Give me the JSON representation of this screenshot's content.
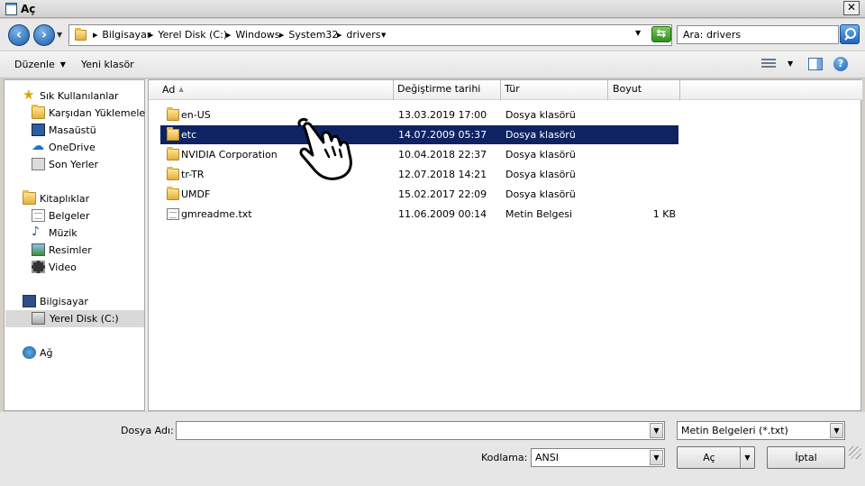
{
  "window": {
    "title": "Aç"
  },
  "address": {
    "crumbs": [
      "Bilgisayar",
      "Yerel Disk (C:)",
      "Windows",
      "System32",
      "drivers"
    ],
    "search_placeholder": "Ara: drivers"
  },
  "toolbar": {
    "organize_label": "Düzenle",
    "new_folder_label": "Yeni klasör"
  },
  "nav": {
    "favorites_label": "Sık Kullanılanlar",
    "favorites": [
      "Karşıdan Yüklemeler",
      "Masaüstü",
      "OneDrive",
      "Son Yerler"
    ],
    "libraries_label": "Kitaplıklar",
    "libraries": [
      "Belgeler",
      "Müzik",
      "Resimler",
      "Video"
    ],
    "computer_label": "Bilgisayar",
    "computer": [
      "Yerel Disk (C:)"
    ],
    "network_label": "Ağ"
  },
  "columns": {
    "name": "Ad",
    "modified": "Değiştirme tarihi",
    "type": "Tür",
    "size": "Boyut"
  },
  "files": [
    {
      "name": "en-US",
      "modified": "13.03.2019 17:00",
      "type": "Dosya klasörü",
      "size": "",
      "kind": "folder"
    },
    {
      "name": "etc",
      "modified": "14.07.2009 05:37",
      "type": "Dosya klasörü",
      "size": "",
      "kind": "folder",
      "selected": true
    },
    {
      "name": "NVIDIA Corporation",
      "modified": "10.04.2018 22:37",
      "type": "Dosya klasörü",
      "size": "",
      "kind": "folder"
    },
    {
      "name": "tr-TR",
      "modified": "12.07.2018 14:21",
      "type": "Dosya klasörü",
      "size": "",
      "kind": "folder"
    },
    {
      "name": "UMDF",
      "modified": "15.02.2017 22:09",
      "type": "Dosya klasörü",
      "size": "",
      "kind": "folder"
    },
    {
      "name": "gmreadme.txt",
      "modified": "11.06.2009 00:14",
      "type": "Metin Belgesi",
      "size": "1 KB",
      "kind": "file"
    }
  ],
  "bottom": {
    "filename_label": "Dosya Adı:",
    "filename_value": "",
    "filter_value": "Metin Belgeleri (*.txt)",
    "encoding_label": "Kodlama:",
    "encoding_value": "ANSI",
    "open_label": "Aç",
    "cancel_label": "İptal"
  },
  "colors": {
    "selection": "#0f2363",
    "chrome": "#d4d0c8"
  }
}
